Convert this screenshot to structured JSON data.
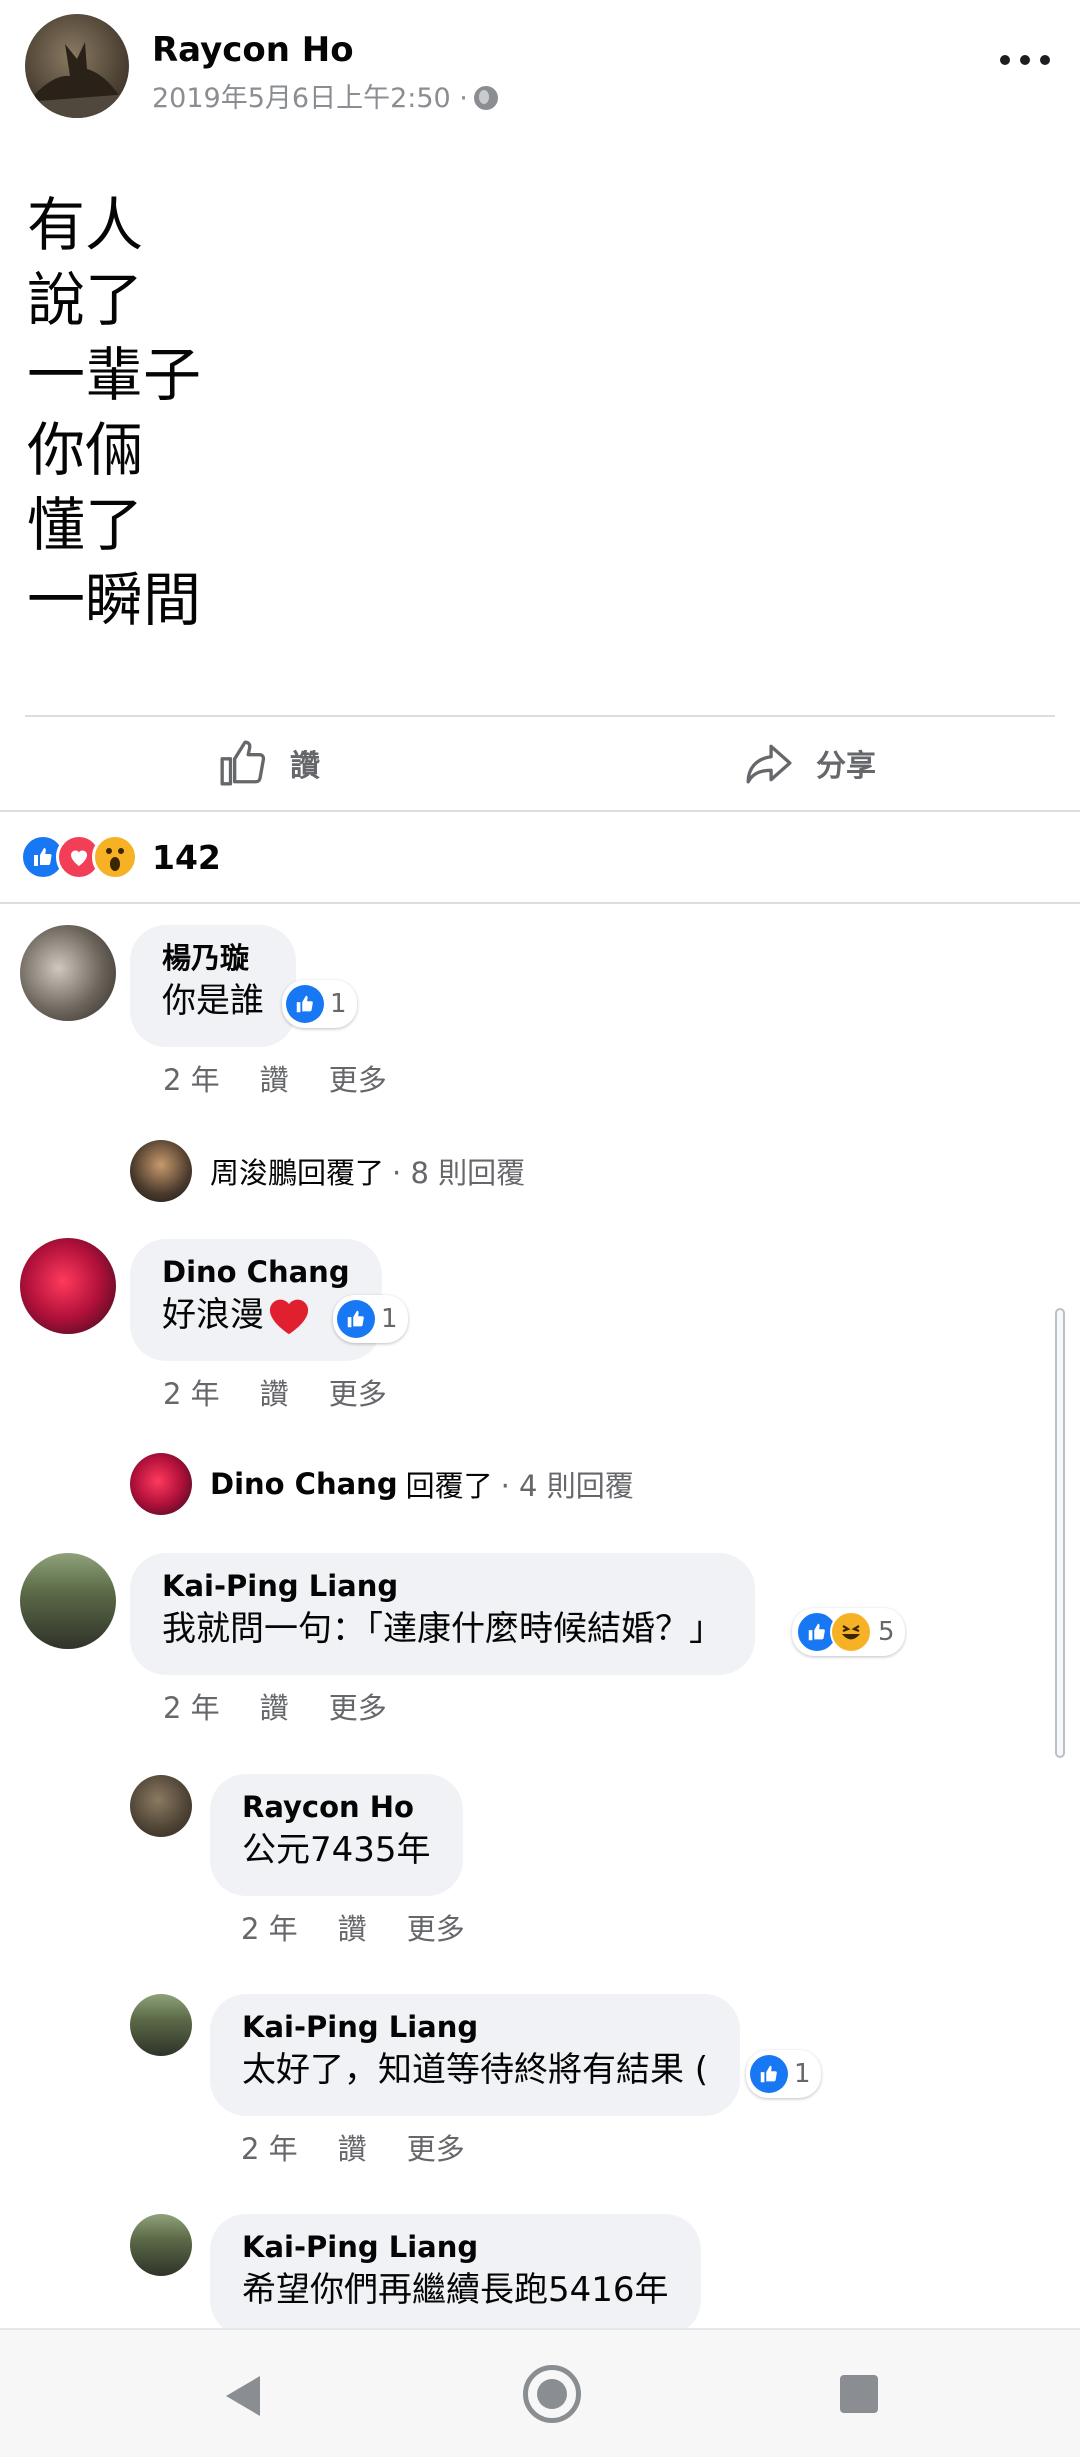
{
  "post": {
    "author": "Raycon Ho",
    "timestamp": "2019年5月6日上午2:50 ·",
    "privacy_icon": "globe-icon",
    "lines": [
      "有人",
      "說了",
      "一輩子",
      "你倆",
      "懂了",
      "一瞬間"
    ]
  },
  "actions": {
    "like_label": "讚",
    "share_label": "分享"
  },
  "reactions": {
    "types": [
      "like",
      "love",
      "wow"
    ],
    "count": "142"
  },
  "comments": [
    {
      "name": "楊乃璇",
      "text": "你是誰",
      "reaction_count": "1",
      "time": "2 年",
      "like": "讚",
      "more": "更多",
      "reply_summary": {
        "who": "周浚鵬回覆了",
        "count": "· 8 則回覆"
      }
    },
    {
      "name": "Dino Chang",
      "text": "好浪漫",
      "reaction_count": "1",
      "time": "2 年",
      "like": "讚",
      "more": "更多",
      "reply_summary": {
        "who": "Dino Chang",
        "verb": "回覆了",
        "count": "· 4 則回覆"
      }
    },
    {
      "name": "Kai-Ping Liang",
      "text": "我就問一句：「達康什麼時候結婚？」",
      "reaction_count": "5",
      "time": "2 年",
      "like": "讚",
      "more": "更多"
    }
  ],
  "replies": [
    {
      "name": "Raycon Ho",
      "text": "公元7435年",
      "time": "2 年",
      "like": "讚",
      "more": "更多"
    },
    {
      "name": "Kai-Ping Liang",
      "text": "太好了，知道等待終將有結果 (",
      "reaction_count": "1",
      "time": "2 年",
      "like": "讚",
      "more": "更多"
    },
    {
      "name": "Kai-Ping Liang",
      "text": "希望你們再繼續長跑5416年"
    }
  ],
  "colors": {
    "like_blue": "#1877f2",
    "love_red": "#f33e58",
    "wow_yellow": "#f7b125",
    "bubble_bg": "#f0f2f5",
    "secondary_text": "#65676b"
  }
}
